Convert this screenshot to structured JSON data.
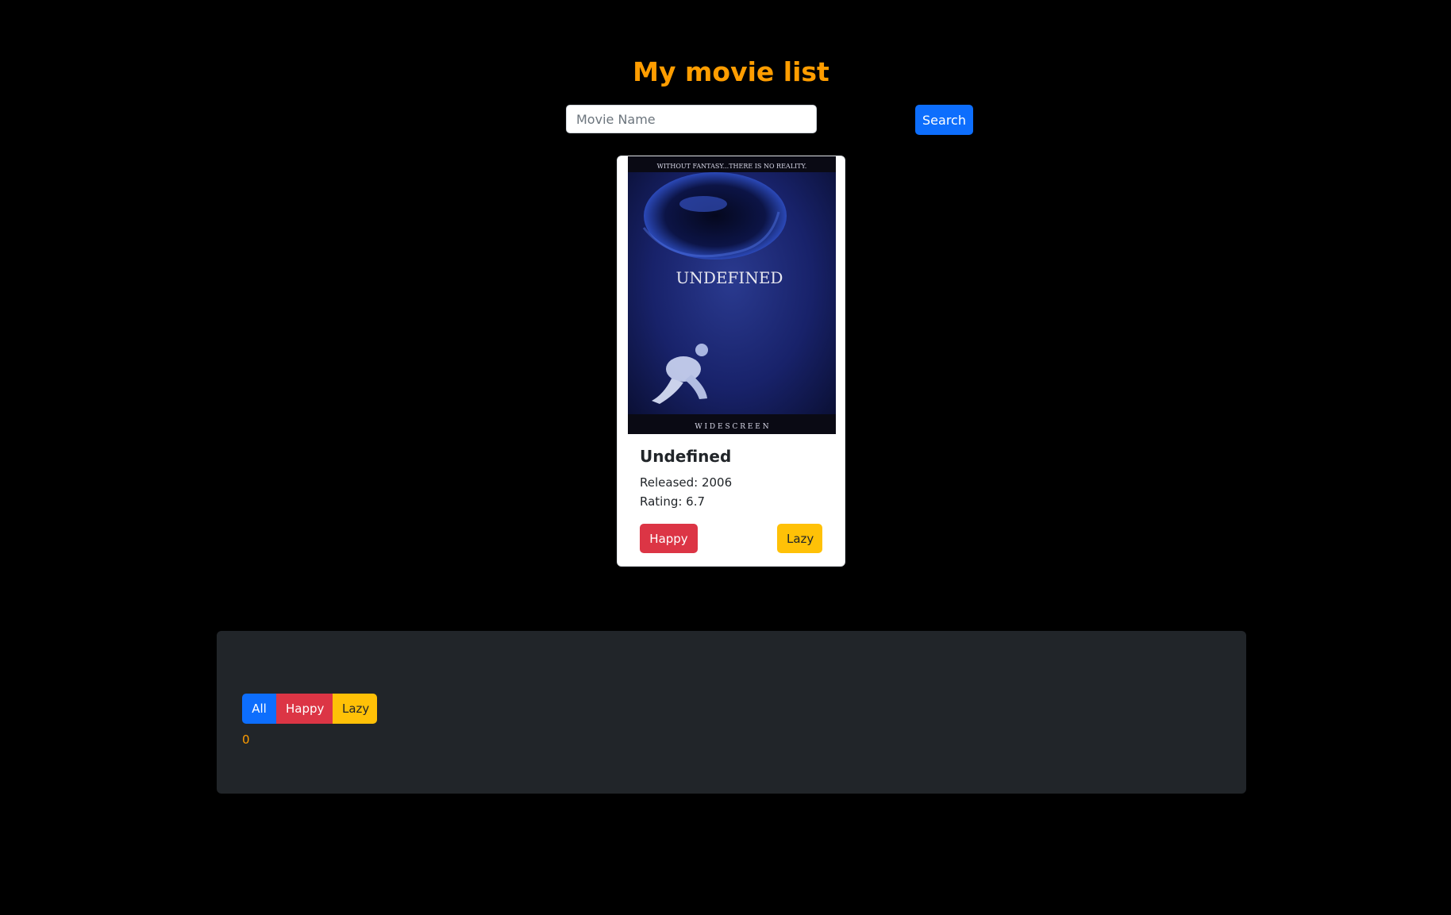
{
  "header": {
    "title": "My movie list"
  },
  "search": {
    "placeholder": "Movie Name",
    "value": "",
    "button_label": "Search"
  },
  "movie": {
    "poster": {
      "tagline": "WITHOUT FANTASY...THERE IS NO REALITY.",
      "title_text": "UNDEFINED",
      "footer_text": "W I D E S C R E E N"
    },
    "title": "Undefined",
    "released": "Released: 2006",
    "rating": "Rating: 6.7",
    "happy_label": "Happy",
    "lazy_label": "Lazy"
  },
  "filters": {
    "all_label": "All",
    "happy_label": "Happy",
    "lazy_label": "Lazy"
  },
  "summary": {
    "count": "0"
  },
  "colors": {
    "accent_orange": "#ff9d00",
    "primary_blue": "#0d6efd",
    "danger_red": "#dc3545",
    "warning_yellow": "#ffc107",
    "panel_dark": "#212529"
  }
}
